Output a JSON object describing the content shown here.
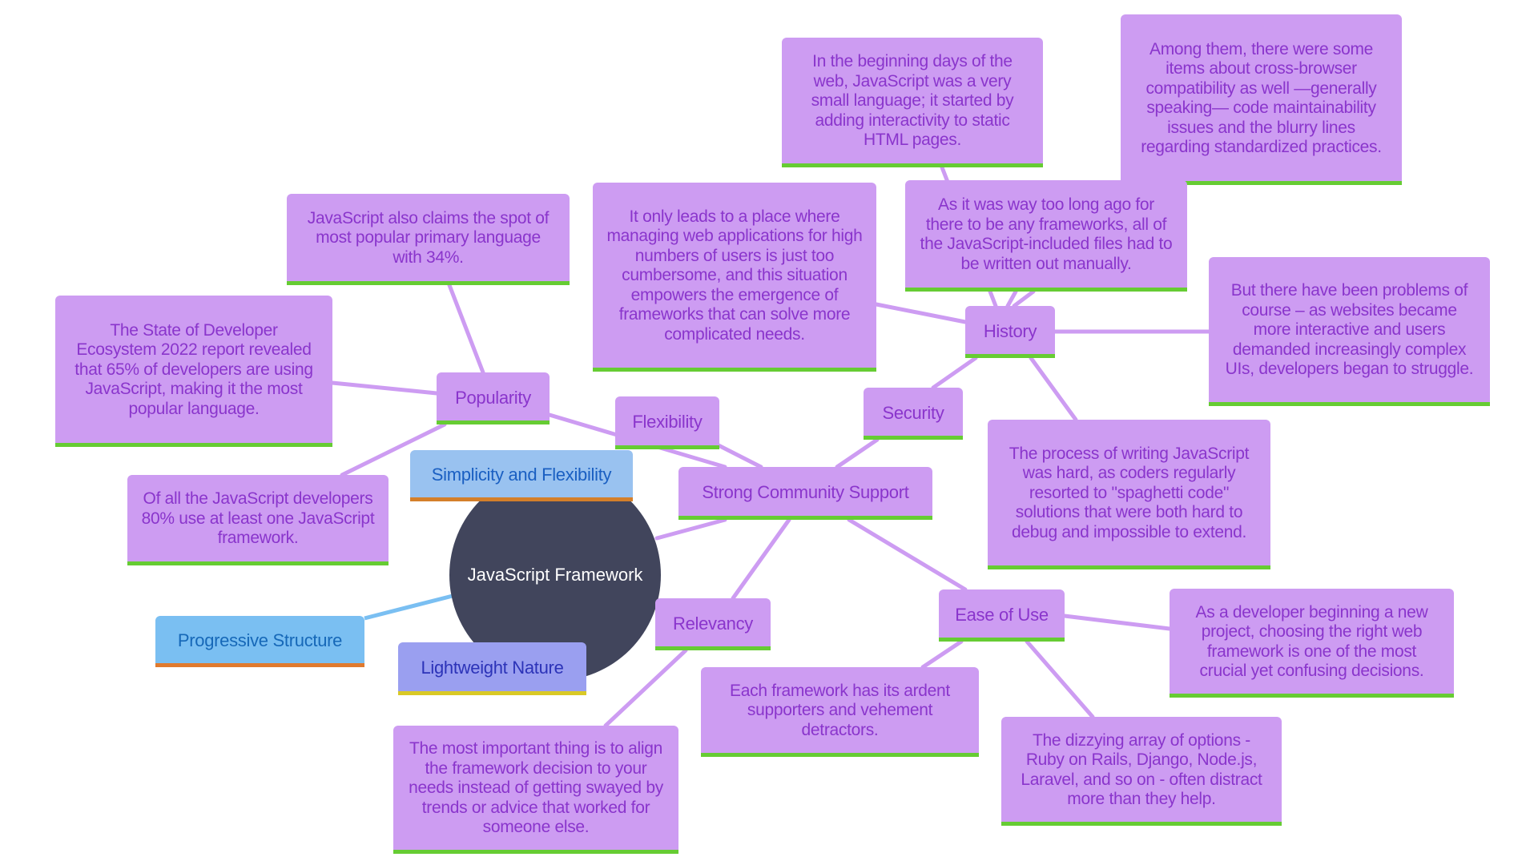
{
  "diagram": {
    "type": "mindmap",
    "root": "JavaScript Framework",
    "branches": {
      "simplicity": "Simplicity and Flexibility",
      "progressive": "Progressive Structure",
      "lightweight": "Lightweight Nature",
      "community": "Strong Community Support",
      "popularity": "Popularity",
      "flexibility": "Flexibility",
      "security": "Security",
      "history": "History",
      "relevancy": "Relevancy",
      "ease": "Ease of Use"
    },
    "leaves": {
      "pop_primary": "JavaScript also claims the spot of most popular primary language with 34%.",
      "pop_state": "The State of Developer Ecosystem 2022 report revealed that 65% of developers are using JavaScript, making it the most popular language.",
      "pop_80": "Of all the JavaScript developers 80% use at least one JavaScript framework.",
      "hist_beginning": "In the beginning days of the web, JavaScript was a very small language; it started by adding interactivity to static HTML pages.",
      "hist_among": "Among them, there were some items about cross-browser compatibility as well —generally speaking— code maintainability issues and the blurry lines regarding standardized practices.",
      "hist_leads": "It only leads to a place where managing web applications for high numbers of users is just too cumbersome, and this situation empowers the emergence of frameworks that can solve more complicated needs.",
      "hist_manual": "As it was way too long ago for there to be any frameworks, all of the JavaScript-included files had to be written out manually.",
      "hist_problems": "But there have been problems of course – as websites became more interactive and users demanded increasingly complex UIs, developers began to struggle.",
      "hist_process": "The process of writing JavaScript was hard, as coders regularly resorted to \"spaghetti code\" solutions that were both hard to debug and impossible to extend.",
      "ease_developer": "As a developer beginning a new project, choosing the right web framework is one of the most crucial yet confusing decisions.",
      "ease_dizzying": "The dizzying array of options - Ruby on Rails, Django, Node.js, Laravel, and so on - often distract more than they help.",
      "ease_each": "Each framework has its ardent supporters and vehement detractors.",
      "rel_important": "The most important thing is to align the framework decision to your needs instead of getting swayed by trends or advice that worked for someone else."
    },
    "colors": {
      "node_fill": "#cd9cf2",
      "node_text": "#8a35cc",
      "node_underline": "#66cc33",
      "edge": "#cd9cf2",
      "root_fill": "#41455c",
      "root_text": "#ffffff",
      "blue_edge": "#7abff2"
    }
  }
}
